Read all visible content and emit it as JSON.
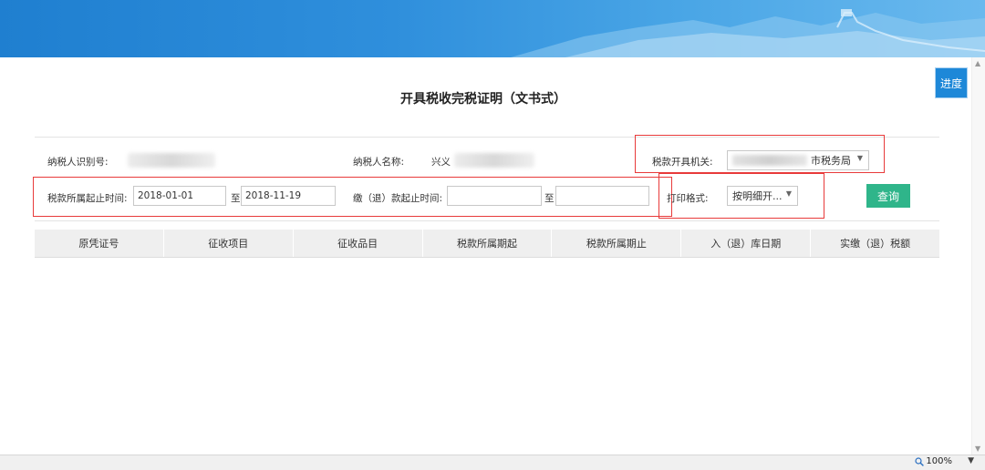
{
  "header": {
    "progress_button": "进度"
  },
  "form": {
    "title": "开具税收完税证明（文书式）",
    "taxpayer_id_label": "纳税人识别号:",
    "taxpayer_name_label": "纳税人名称:",
    "taxpayer_name_value": "兴义",
    "tax_office_label": "税款开具机关:",
    "tax_office_value": "市税务局",
    "period_label": "税款所属起止时间:",
    "period_start": "2018-01-01",
    "period_to": "至",
    "period_end": "2018-11-19",
    "payment_label": "缴（退）款起止时间:",
    "payment_start": "",
    "payment_to": "至",
    "payment_end": "",
    "print_format_label": "打印格式:",
    "print_format_value": "按明细开...",
    "query_button": "查询"
  },
  "table": {
    "columns": [
      "原凭证号",
      "征收项目",
      "征收品目",
      "税款所属期起",
      "税款所属期止",
      "入（退）库日期",
      "实缴（退）税额"
    ]
  },
  "statusbar": {
    "zoom": "100%"
  },
  "colors": {
    "banner": "#2f8fdc",
    "accent": "#1e88d8",
    "query": "#2fb58a",
    "highlight": "#e83a3a"
  }
}
